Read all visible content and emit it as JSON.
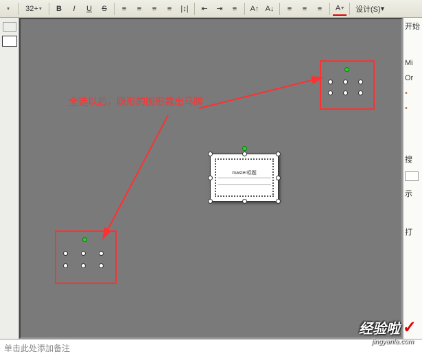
{
  "toolbar": {
    "fontsize": "32+",
    "bold": "B",
    "italic": "I",
    "underline": "U",
    "strike": "S",
    "align_left_icon": "≡",
    "align_center_icon": "≡",
    "align_right_icon": "≡",
    "align_justify_icon": "≡",
    "line_spacing_icon": "|↕|",
    "indent_dec_icon": "⇤",
    "indent_inc_icon": "⇥",
    "list_num_icon": "≡",
    "list_bullet_icon": "≡",
    "font_big": "A↑",
    "font_small": "A↓",
    "color_icon": "A",
    "design_label": "设计(S)"
  },
  "right_panel": {
    "start": "开始",
    "mi": "Mi",
    "or": "Or",
    "search": "搜",
    "demo": "示",
    "open": "打"
  },
  "annotation": {
    "text": "全选以后，隐形的图形露出马脚"
  },
  "center": {
    "label": "master标题"
  },
  "notes": {
    "placeholder": "单击此处添加备注"
  },
  "watermark": {
    "text": "经验啦",
    "check": "✓",
    "url": "jingyanla.com"
  }
}
